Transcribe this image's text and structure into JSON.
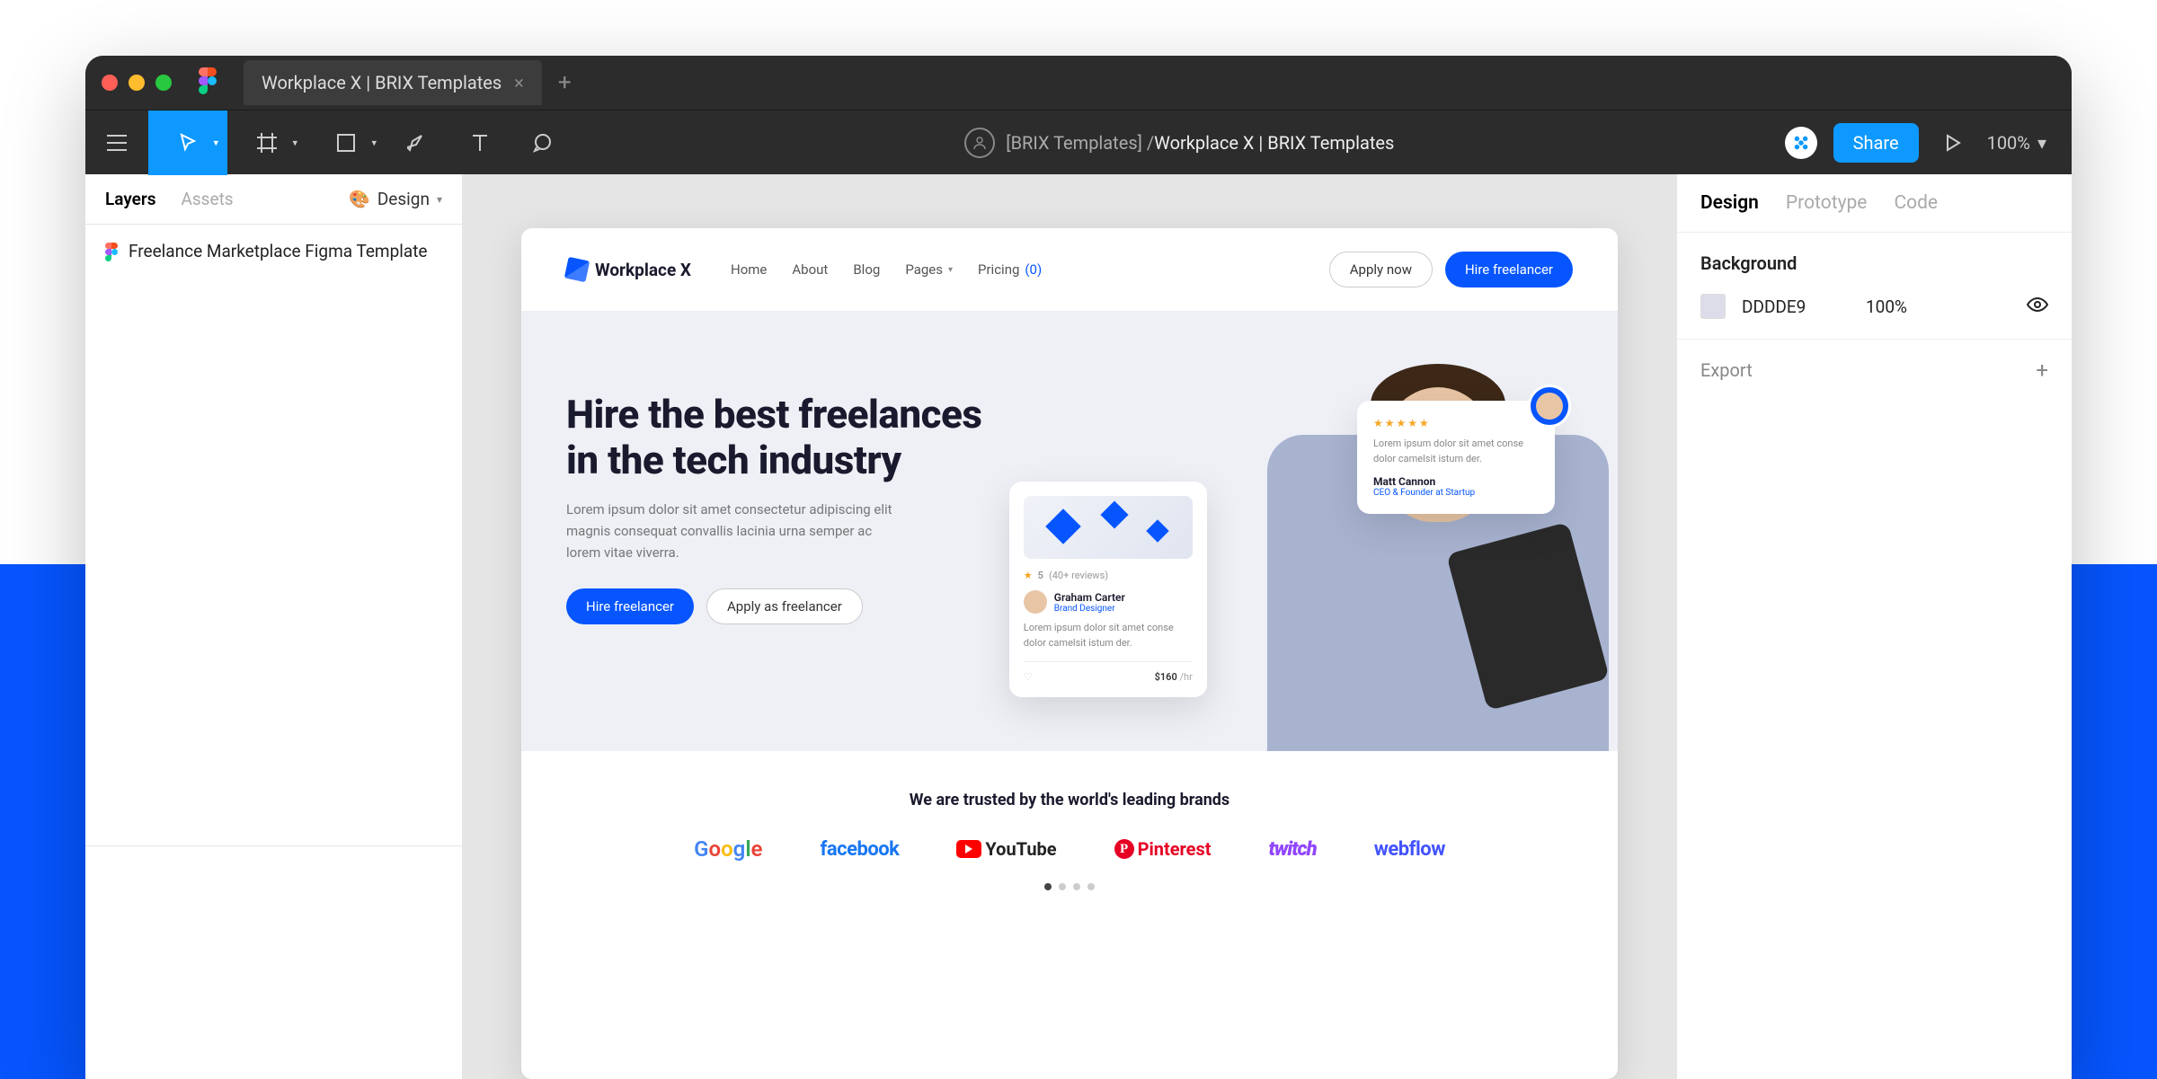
{
  "tabbar": {
    "title": "Workplace X | BRIX Templates"
  },
  "toolbar": {
    "team": "[BRIX Templates] /",
    "file": "Workplace X | BRIX Templates",
    "share": "Share",
    "zoom": "100%"
  },
  "left_panel": {
    "tabs": {
      "layers": "Layers",
      "assets": "Assets"
    },
    "design_link": "Design",
    "root_layer": "Freelance Marketplace Figma Template"
  },
  "right_panel": {
    "tabs": {
      "design": "Design",
      "prototype": "Prototype",
      "code": "Code"
    },
    "bg_section": "Background",
    "bg_hex": "DDDDE9",
    "bg_opacity": "100%",
    "export": "Export"
  },
  "site": {
    "logo": "Workplace X",
    "nav": {
      "home": "Home",
      "about": "About",
      "blog": "Blog",
      "pages": "Pages",
      "pricing": "Pricing",
      "pricing_badge": "(0)"
    },
    "actions": {
      "apply": "Apply now",
      "hire": "Hire freelancer"
    },
    "hero": {
      "title": "Hire the best freelances in the tech industry",
      "desc": "Lorem ipsum dolor sit amet consectetur adipiscing elit magnis consequat convallis lacinia urna semper ac lorem vitae viverra.",
      "btn_hire": "Hire freelancer",
      "btn_apply": "Apply as freelancer"
    },
    "card_freelancer": {
      "rating_value": "5",
      "rating_count": "(40+ reviews)",
      "name": "Graham Carter",
      "role": "Brand Designer",
      "desc": "Lorem ipsum dolor sit amet conse dolor camelsit istum der.",
      "price": "$160",
      "unit": "/hr"
    },
    "card_review": {
      "text": "Lorem ipsum dolor sit amet conse dolor camelsit istum der.",
      "name": "Matt Cannon",
      "role": "CEO & Founder at Startup"
    },
    "trusted": {
      "title": "We are trusted by the world's leading brands",
      "brands": {
        "google": "Google",
        "facebook": "facebook",
        "youtube": "YouTube",
        "pinterest": "Pinterest",
        "twitch": "twitch",
        "webflow": "webflow"
      }
    }
  }
}
